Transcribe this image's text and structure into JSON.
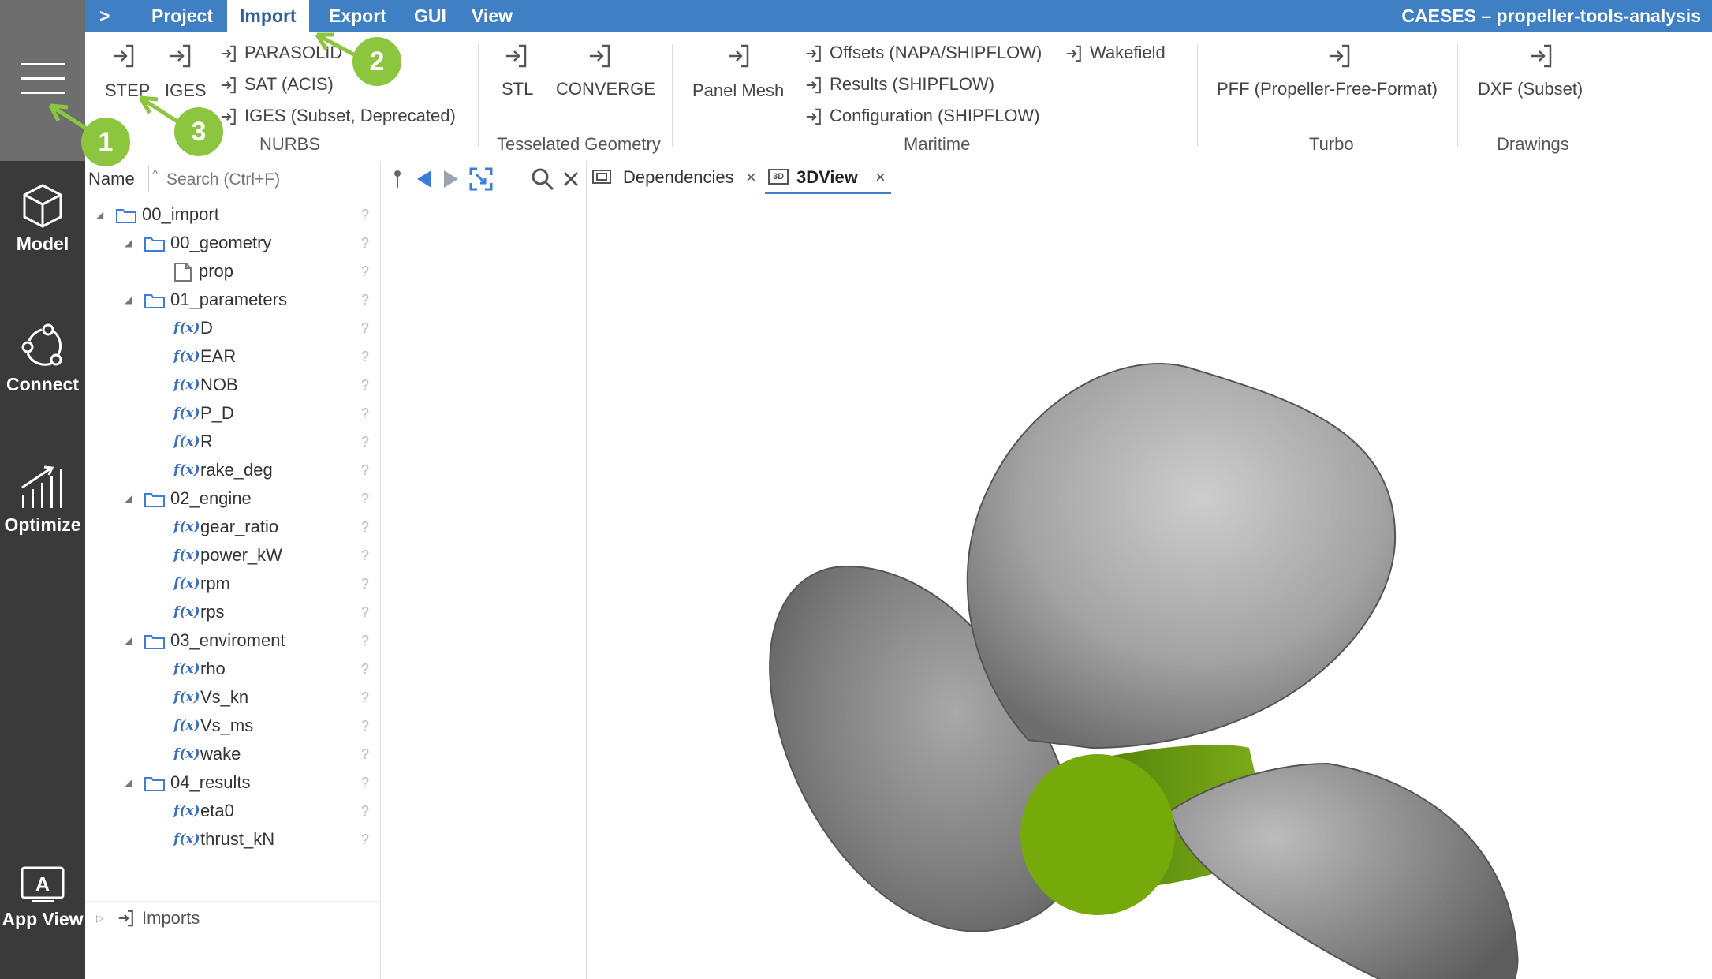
{
  "app_title": "CAESES  –  propeller-tools-analysis",
  "menu": {
    "expand": ">",
    "items": [
      "Project",
      "Import",
      "Export",
      "GUI",
      "View"
    ]
  },
  "rail": {
    "model": "Model",
    "connect": "Connect",
    "optimize": "Optimize",
    "appview": "App View"
  },
  "ribbon": {
    "nurbs": {
      "step": "STEP",
      "iges": "IGES",
      "parasolid": "PARASOLID",
      "sat": "SAT (ACIS)",
      "iges_subset": "IGES (Subset, Deprecated)",
      "group": "NURBS"
    },
    "tess": {
      "stl": "STL",
      "converge": "CONVERGE",
      "group": "Tesselated Geometry"
    },
    "maritime": {
      "panel_mesh": "Panel Mesh",
      "offsets": "Offsets (NAPA/SHIPFLOW)",
      "results": "Results (SHIPFLOW)",
      "configuration": "Configuration (SHIPFLOW)",
      "wakefield": "Wakefield",
      "group": "Maritime"
    },
    "turbo": {
      "pff": "PFF (Propeller-Free-Format)",
      "group": "Turbo"
    },
    "drawings": {
      "dxf": "DXF (Subset)",
      "group": "Drawings"
    }
  },
  "tree": {
    "header": "Name",
    "search_placeholder": "Search (Ctrl+F)",
    "nodes": {
      "import": "00_import",
      "geometry": "00_geometry",
      "prop": "prop",
      "parameters": "01_parameters",
      "p_D": "D",
      "p_EAR": "EAR",
      "p_NOB": "NOB",
      "p_PD": "P_D",
      "p_R": "R",
      "p_rake": "rake_deg",
      "engine": "02_engine",
      "e_gear": "gear_ratio",
      "e_power": "power_kW",
      "e_rpm": "rpm",
      "e_rps": "rps",
      "enviroment": "03_enviroment",
      "v_rho": "rho",
      "v_vskn": "Vs_kn",
      "v_vsms": "Vs_ms",
      "v_wake": "wake",
      "results": "04_results",
      "r_eta": "eta0",
      "r_thrust": "thrust_kN",
      "imports": "Imports"
    },
    "fx_label": "f(x)",
    "unknown_mark": "?"
  },
  "tabs": {
    "dependencies": "Dependencies",
    "view3d": "3DView",
    "close": "×",
    "view3d_icon": "3D"
  },
  "callouts": [
    "1",
    "2",
    "3"
  ],
  "colors": {
    "menubar": "#3f7fc4",
    "rail": "#3a3a3a",
    "callout": "#8cc63f",
    "hub": "#76aa0a",
    "blade": "#9a9a9a",
    "fx": "#3b6ec0"
  }
}
